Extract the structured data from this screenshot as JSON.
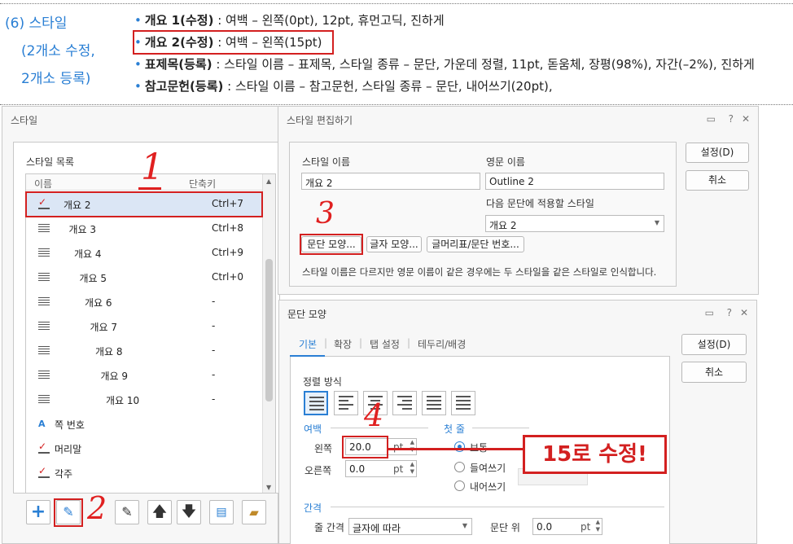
{
  "header": {
    "section": "(6) 스타일",
    "sub1": "(2개소 수정,",
    "sub2": "2개소 등록)",
    "lines": [
      {
        "title": "개요 1(수정)",
        "rest": " : 여백 – 왼쪽(0pt), 12pt, 휴먼고딕, 진하게"
      },
      {
        "title": "개요 2(수정)",
        "rest": " : 여백 – 왼쪽(15pt)"
      },
      {
        "title": "표제목(등록)",
        "rest": " : 스타일 이름 – 표제목, 스타일 종류 – 문단, 가운데 정렬, 11pt, 돋움체, 장평(98%), 자간(–2%), 진하게"
      },
      {
        "title": "참고문헌(등록)",
        "rest": " : 스타일 이름 – 참고문헌, 스타일 종류 – 문단, 내어쓰기(20pt),"
      }
    ]
  },
  "style_dialog": {
    "title": "스타일",
    "list_label": "스타일 목록",
    "col_name": "이름",
    "col_shortcut": "단축키",
    "items": [
      {
        "name": "개요 2",
        "shortcut": "Ctrl+7",
        "icon": "paragraph-checked-icon"
      },
      {
        "name": "개요 3",
        "shortcut": "Ctrl+8",
        "icon": "paragraph-style-icon"
      },
      {
        "name": "개요 4",
        "shortcut": "Ctrl+9",
        "icon": "paragraph-style-icon"
      },
      {
        "name": "개요 5",
        "shortcut": "Ctrl+0",
        "icon": "paragraph-style-icon"
      },
      {
        "name": "개요 6",
        "shortcut": "-",
        "icon": "paragraph-style-icon"
      },
      {
        "name": "개요 7",
        "shortcut": "-",
        "icon": "paragraph-style-icon"
      },
      {
        "name": "개요 8",
        "shortcut": "-",
        "icon": "paragraph-style-icon"
      },
      {
        "name": "개요 9",
        "shortcut": "-",
        "icon": "paragraph-style-icon"
      },
      {
        "name": "개요 10",
        "shortcut": "-",
        "icon": "paragraph-style-icon"
      },
      {
        "name": "쪽 번호",
        "shortcut": "",
        "icon": "character-style-icon"
      },
      {
        "name": "머리말",
        "shortcut": "",
        "icon": "paragraph-checked-icon"
      },
      {
        "name": "각주",
        "shortcut": "",
        "icon": "paragraph-checked-icon"
      }
    ]
  },
  "edit_dialog": {
    "title": "스타일 편집하기",
    "style_name_label": "스타일 이름",
    "style_name_value": "개요 2",
    "eng_name_label": "영문 이름",
    "eng_name_value": "Outline 2",
    "next_label": "다음 문단에 적용할 스타일",
    "next_value": "개요 2",
    "btn_para": "문단 모양...",
    "btn_char": "글자 모양...",
    "btn_bullet": "글머리표/문단 번호...",
    "note": "스타일 이름은 다르지만 영문 이름이 같은 경우에는 두 스타일을 같은 스타일로 인식합니다.",
    "ok": "설정(D)",
    "cancel": "취소"
  },
  "para_dialog": {
    "title": "문단 모양",
    "tabs": [
      "기본",
      "확장",
      "탭 설정",
      "테두리/배경"
    ],
    "align_label": "정렬 방식",
    "margin_label": "여백",
    "left_label": "왼쪽",
    "left_value": "20.0",
    "right_label": "오른쪽",
    "right_value": "0.0",
    "unit": "pt",
    "first_label": "첫 줄",
    "first_opts": [
      "보통",
      "들여쓰기",
      "내어쓰기"
    ],
    "spacing_label": "간격",
    "line_label": "줄 간격",
    "line_value": "글자에 따라",
    "before_label": "문단 위",
    "before_value": "0.0",
    "ok": "설정(D)",
    "cancel": "취소"
  },
  "annotations": {
    "n1": "1",
    "n2": "2",
    "n3": "3",
    "n4": "4",
    "callout": "15로 수정!"
  },
  "colors": {
    "accent": "#2a7fd4",
    "red": "#d32020"
  }
}
